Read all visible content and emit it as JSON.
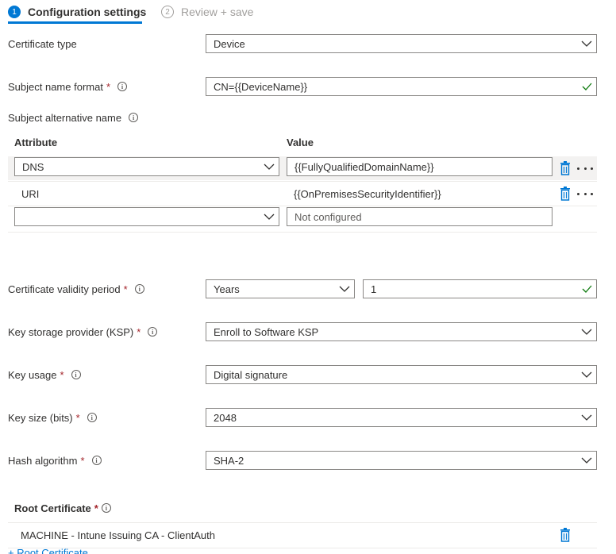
{
  "tabs": [
    {
      "step": "1",
      "label": "Configuration settings"
    },
    {
      "step": "2",
      "label": "Review + save"
    }
  ],
  "certificate_type": {
    "label": "Certificate type",
    "value": "Device"
  },
  "subject_name_format": {
    "label": "Subject name format",
    "required": "*",
    "info": "i",
    "value": "CN={{DeviceName}}"
  },
  "subject_alternative_name": {
    "label": "Subject alternative name",
    "info": "i",
    "columns": {
      "attribute": "Attribute",
      "value": "Value"
    },
    "rows": [
      {
        "attribute": "DNS",
        "value": "{{FullyQualifiedDomainName}}"
      },
      {
        "attribute": "URI",
        "value": "{{OnPremisesSecurityIdentifier}}"
      },
      {
        "attribute": "",
        "placeholder": "Not configured"
      }
    ]
  },
  "validity_period": {
    "label": "Certificate validity period",
    "required": "*",
    "info": "i",
    "unit": "Years",
    "value": "1"
  },
  "ksp": {
    "label": "Key storage provider (KSP)",
    "required": "*",
    "info": "i",
    "value": "Enroll to Software KSP"
  },
  "key_usage": {
    "label": "Key usage",
    "required": "*",
    "info": "i",
    "value": "Digital signature"
  },
  "key_size": {
    "label": "Key size (bits)",
    "required": "*",
    "info": "i",
    "value": "2048"
  },
  "hash_algorithm": {
    "label": "Hash algorithm",
    "required": "*",
    "info": "i",
    "value": "SHA-2"
  },
  "root_certificate": {
    "label": "Root Certificate",
    "required": "*",
    "info": "i",
    "value": "MACHINE - Intune Issuing CA - ClientAuth",
    "add_link": "+ Root Certificate"
  },
  "colors": {
    "accent": "#0078d4",
    "required": "#a4262c",
    "success": "#107c10"
  },
  "icons": [
    "chevron-down-icon",
    "checkmark-icon",
    "info-icon",
    "trash-icon",
    "more-icon"
  ]
}
